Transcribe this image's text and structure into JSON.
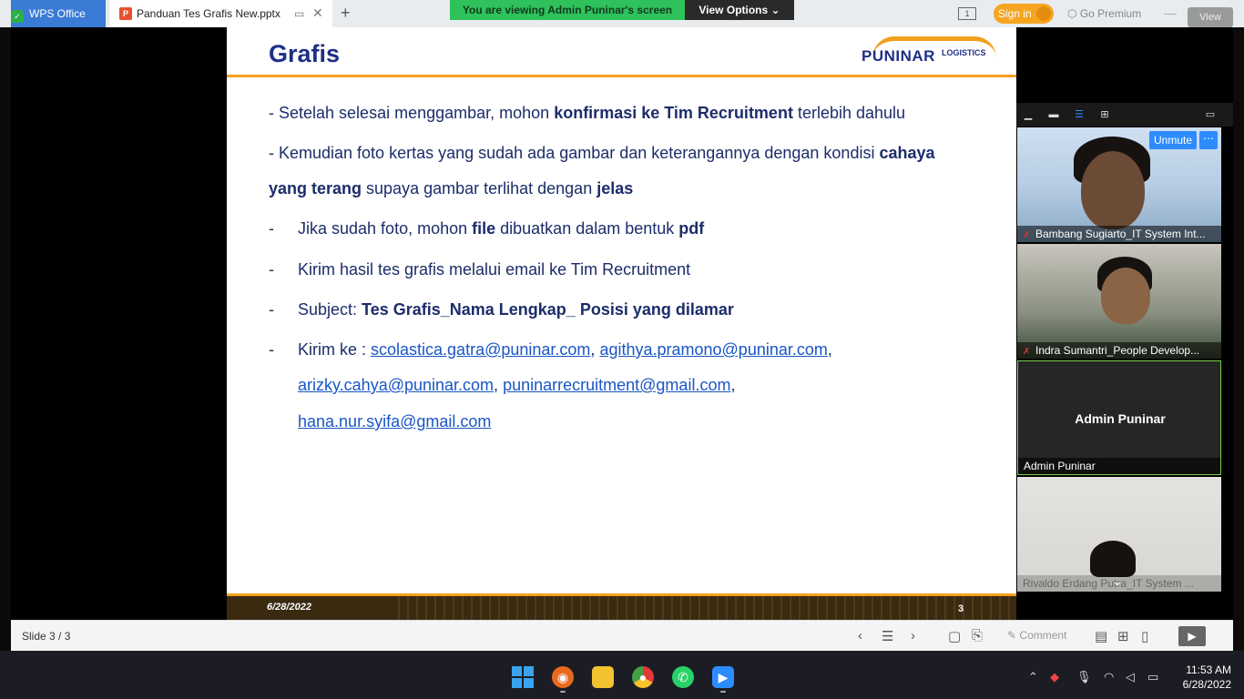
{
  "titlebar": {
    "wps_tab": "WPS Office",
    "doc_tab": "Panduan Tes Grafis New.pptx",
    "share_banner": "You are viewing Admin Puninar's screen",
    "view_options": "View Options",
    "sign_in": "Sign in",
    "go_premium": "Go Premium",
    "view_overlay": "View"
  },
  "slide": {
    "title": "Grafis",
    "logo_text": "PUNINAR",
    "logo_sub": "LOGISTICS",
    "line1_a": "- Setelah selesai menggambar, mohon ",
    "line1_b": "konfirmasi ke Tim Recruitment",
    "line1_c": " terlebih dahulu",
    "line2_a": "- Kemudian foto kertas yang sudah ada gambar dan keterangannya dengan kondisi ",
    "line2_b": "cahaya",
    "line3_a": "yang terang",
    "line3_b": " supaya gambar terlihat dengan ",
    "line3_c": "jelas",
    "bullet1_a": "Jika sudah foto, mohon ",
    "bullet1_b": "file",
    "bullet1_c": " dibuatkan dalam bentuk ",
    "bullet1_d": "pdf",
    "bullet2": "Kirim hasil tes grafis melalui email ke Tim Recruitment",
    "bullet3_a": "Subject: ",
    "bullet3_b": "Tes Grafis_Nama Lengkap_ Posisi yang dilamar",
    "bullet4_prefix": "Kirim ke : ",
    "emails": [
      "scolastica.gatra@puninar.com",
      "agithya.pramono@puninar.com",
      "arizky.cahya@puninar.com",
      "puninarrecruitment@gmail.com",
      "hana.nur.syifa@gmail.com"
    ],
    "dash": "-",
    "comma": ",",
    "footer_date": "6/28/2022",
    "footer_page": "3"
  },
  "participants": {
    "unmute": "Unmute",
    "more": "⋯",
    "p1": "Bambang Sugiarto_IT System Int...",
    "p2": "Indra Sumantri_People Develop...",
    "p3_center": "Admin Puninar",
    "p3": "Admin Puninar",
    "p4": "Rivaldo Erdang Putra_IT System ..."
  },
  "statusbar": {
    "slide_count": "Slide 3 / 3",
    "comment": "Comment"
  },
  "taskbar": {
    "time": "11:53 AM",
    "date": "6/28/2022"
  },
  "colors": {
    "brand_blue": "#1f2f86",
    "accent_orange": "#f2a01e",
    "link_blue": "#1a56c6",
    "share_green": "#2fc15c",
    "zoom_blue": "#2d8cff"
  }
}
